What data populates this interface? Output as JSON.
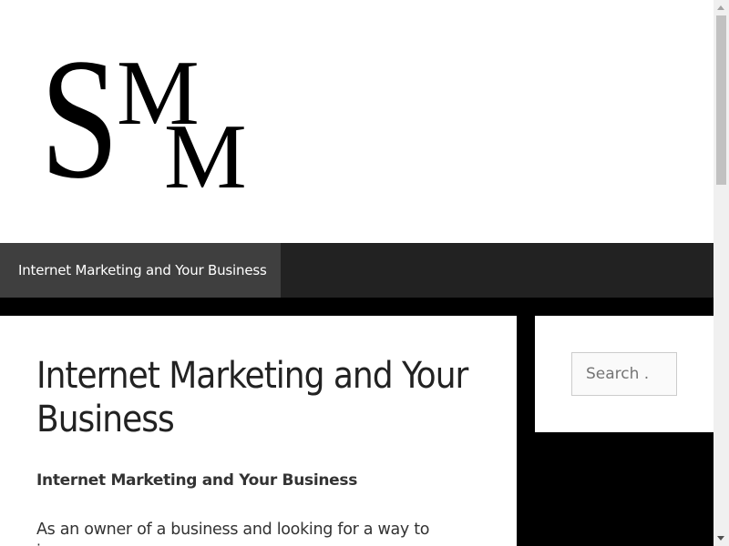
{
  "site": {
    "logo_text": "SMM",
    "logo_color": "#000000"
  },
  "nav": {
    "items": [
      {
        "label": "Internet Marketing and Your Business"
      }
    ]
  },
  "article": {
    "title": "Internet Marketing and Your Business",
    "subheading": "Internet Marketing and Your Business",
    "paragraph": "As an owner of a business and looking for a way to increase"
  },
  "sidebar": {
    "search": {
      "placeholder": "Search .."
    }
  },
  "colors": {
    "page_bg": "#000000",
    "nav_bg": "#222222",
    "nav_active_bg": "#3f3f3f",
    "content_bg": "#ffffff"
  },
  "scrollbar": {
    "position_fraction": 0
  }
}
